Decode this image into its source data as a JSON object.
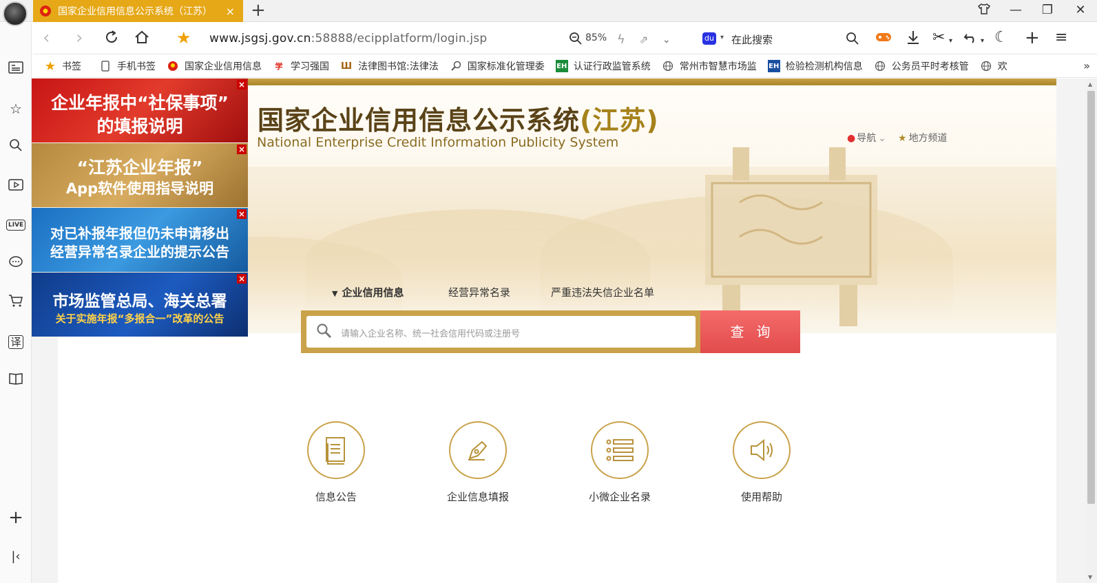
{
  "tab": {
    "title": "国家企业信用信息公示系统（江苏）",
    "close": "×",
    "new_tab": "+"
  },
  "window": {
    "skin_icon": "shirt-icon",
    "minimize": "—",
    "restore": "❐",
    "close": "✕"
  },
  "address_bar": {
    "url_domain": "www.jsgsj.gov.cn",
    "url_rest": ":58888/ecipplatform/login.jsp",
    "zoom": "85%",
    "search_placeholder": "在此搜索",
    "search_engine_icon": "baidu-paw-icon"
  },
  "bookmarks": [
    {
      "label": "书签",
      "icon": "star-icon"
    },
    {
      "label": "手机书签",
      "icon": "phone-icon"
    },
    {
      "label": "国家企业信用信息",
      "icon": "emblem-icon"
    },
    {
      "label": "学习强国",
      "icon": "xuexi-icon"
    },
    {
      "label": "法律图书馆:法律法",
      "icon": "law-library-icon"
    },
    {
      "label": "国家标准化管理委",
      "icon": "magnifier-icon"
    },
    {
      "label": "认证行政监管系统",
      "icon": "cert-icon"
    },
    {
      "label": "常州市智慧市场监",
      "icon": "globe-icon"
    },
    {
      "label": "检验检测机构信息",
      "icon": "cert-icon"
    },
    {
      "label": "公务员平时考核管",
      "icon": "globe-icon"
    },
    {
      "label": "欢",
      "icon": "globe-icon"
    }
  ],
  "bookmarks_more": "»",
  "banners": [
    {
      "line1": "企业年报中“社保事项”",
      "line2": "的填报说明",
      "close": "×"
    },
    {
      "line1": "“江苏企业年报”",
      "line2": "App软件使用指导说明",
      "close": "×"
    },
    {
      "line1": "对已补报年报但仍未申请移出",
      "line2": "经营异常名录企业的提示公告",
      "close": "×"
    },
    {
      "line1": "市场监管总局、海关总署",
      "line2": "关于实施年报“多报合一”改革的公告",
      "close": "×"
    }
  ],
  "header": {
    "title_main": "国家企业信用信息公示系统",
    "title_region": "(江苏)",
    "title_en": "National Enterprise Credit Information Publicity System",
    "nav_guide": "导航",
    "nav_local": "地方频道"
  },
  "search": {
    "tabs": [
      {
        "label": "企业信用信息",
        "active": true
      },
      {
        "label": "经营异常名录",
        "active": false
      },
      {
        "label": "严重违法失信企业名单",
        "active": false
      }
    ],
    "placeholder": "请输入企业名称、统一社会信用代码或注册号",
    "button": "查询"
  },
  "features": [
    {
      "label": "信息公告",
      "icon": "document-icon"
    },
    {
      "label": "企业信息填报",
      "icon": "pen-icon"
    },
    {
      "label": "小微企业名录",
      "icon": "list-icon"
    },
    {
      "label": "使用帮助",
      "icon": "speaker-icon"
    }
  ],
  "colors": {
    "accent_gold": "#c9a24a",
    "tab_orange": "#e6a817",
    "search_red": "#e24b4b"
  }
}
